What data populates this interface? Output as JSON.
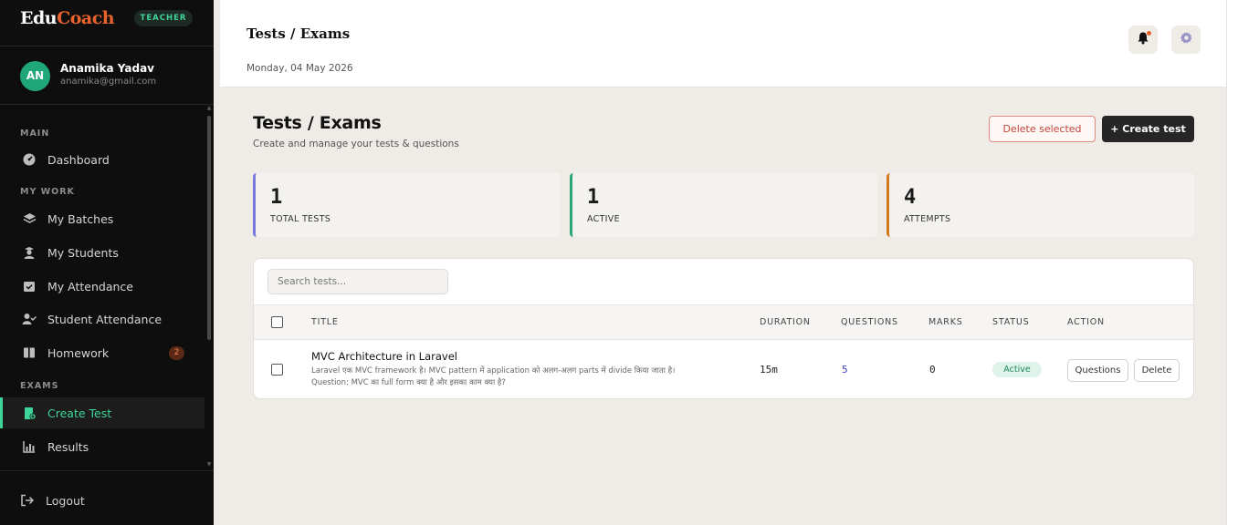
{
  "brand": {
    "part1": "Edu",
    "part2": "Coach",
    "role": "TEACHER"
  },
  "user": {
    "initials": "AN",
    "name": "Anamika Yadav",
    "email": "anamika@gmail.com"
  },
  "sidebar": {
    "sections": {
      "main": "MAIN",
      "my_work": "MY WORK",
      "exams": "EXAMS"
    },
    "items": [
      {
        "label": "Dashboard",
        "icon": "dashboard-icon"
      },
      {
        "label": "My Batches",
        "icon": "layers-icon"
      },
      {
        "label": "My Students",
        "icon": "student-icon"
      },
      {
        "label": "My Attendance",
        "icon": "calendar-check-icon"
      },
      {
        "label": "Student Attendance",
        "icon": "user-check-icon"
      },
      {
        "label": "Homework",
        "icon": "book-icon",
        "badge": "2"
      },
      {
        "label": "Create Test",
        "icon": "file-add-icon",
        "active": true
      },
      {
        "label": "Results",
        "icon": "bar-chart-icon"
      }
    ],
    "logout": "Logout"
  },
  "header": {
    "title": "Tests / Exams",
    "date": "Monday, 04 May 2026"
  },
  "page": {
    "title": "Tests / Exams",
    "subtitle": "Create and manage your tests & questions",
    "delete_selected": "Delete selected",
    "create_test": "+ Create test"
  },
  "stats": [
    {
      "value": "1",
      "label": "TOTAL TESTS",
      "color": "#7a78d8"
    },
    {
      "value": "1",
      "label": "ACTIVE",
      "color": "#2aa57a"
    },
    {
      "value": "4",
      "label": "ATTEMPTS",
      "color": "#d07a1a"
    }
  ],
  "table": {
    "search_placeholder": "Search tests...",
    "columns": [
      "TITLE",
      "DURATION",
      "QUESTIONS",
      "MARKS",
      "STATUS",
      "ACTION"
    ],
    "rows": [
      {
        "title": "MVC Architecture in Laravel",
        "description": "Laravel एक MVC framework है। MVC pattern में application को अलग-अलग parts में divide किया जाता है। Question: MVC का full form क्या है और इसका काम क्या है?",
        "duration": "15m",
        "questions": "5",
        "marks": "0",
        "status": "Active",
        "actions": {
          "questions": "Questions",
          "delete": "Delete"
        }
      }
    ]
  },
  "colors": {
    "accent": "#3fd59a",
    "brand_orange": "#e8632c",
    "sidebar_bg": "#0e0e0e",
    "content_bg": "#efece7"
  }
}
